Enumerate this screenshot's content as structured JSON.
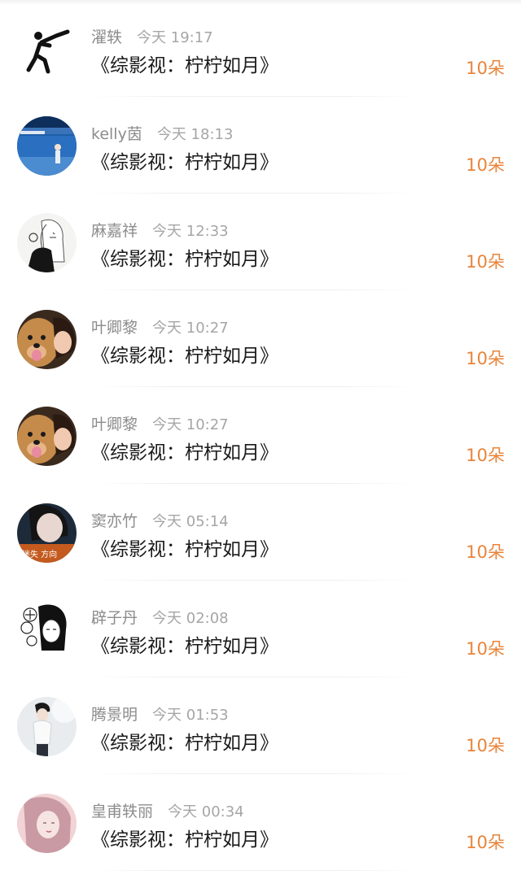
{
  "gifts": [
    {
      "name": "濯轶",
      "time": "今天 19:17",
      "title": "《综影视：柠柠如月》",
      "amount": "10朵",
      "avatar_icon": "shooter-pictogram-icon"
    },
    {
      "name": "kelly茵",
      "time": "今天 18:13",
      "title": "《综影视：柠柠如月》",
      "amount": "10朵",
      "avatar_icon": "ocean-photo-avatar"
    },
    {
      "name": "麻嘉祥",
      "time": "今天 12:33",
      "title": "《综影视：柠柠如月》",
      "amount": "10朵",
      "avatar_icon": "sketch-girl-avatar"
    },
    {
      "name": "叶卿黎",
      "time": "今天 10:27",
      "title": "《综影视：柠柠如月》",
      "amount": "10朵",
      "avatar_icon": "dog-selfie-avatar"
    },
    {
      "name": "叶卿黎",
      "time": "今天 10:27",
      "title": "《综影视：柠柠如月》",
      "amount": "10朵",
      "avatar_icon": "dog-selfie-avatar"
    },
    {
      "name": "窦亦竹",
      "time": "今天 05:14",
      "title": "《综影视：柠柠如月》",
      "amount": "10朵",
      "avatar_icon": "girl-photo-avatar"
    },
    {
      "name": "辟子丹",
      "time": "今天 02:08",
      "title": "《综影视：柠柠如月》",
      "amount": "10朵",
      "avatar_icon": "flower-sketch-avatar"
    },
    {
      "name": "腾景明",
      "time": "今天 01:53",
      "title": "《综影视：柠柠如月》",
      "amount": "10朵",
      "avatar_icon": "boy-photo-avatar"
    },
    {
      "name": "皇甫轶丽",
      "time": "今天 00:34",
      "title": "《综影视：柠柠如月》",
      "amount": "10朵",
      "avatar_icon": "pink-portrait-avatar"
    }
  ],
  "avatar_text": "迷失 方向",
  "colors": {
    "amount": "#e8843a",
    "name": "#8c8c8c",
    "title": "#1a1a1a",
    "divider": "#eeeeee"
  }
}
